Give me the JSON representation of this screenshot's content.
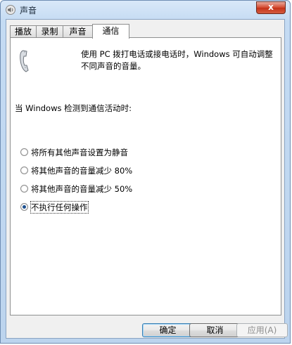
{
  "window": {
    "title": "声音",
    "close_label": "x"
  },
  "tabs": [
    {
      "label": "播放"
    },
    {
      "label": "录制"
    },
    {
      "label": "声音"
    },
    {
      "label": "通信"
    }
  ],
  "communications": {
    "description": "使用 PC 拨打电话或接电话时，Windows 可自动调整不同声音的音量。",
    "section_label": "当 Windows 检测到通信活动时:",
    "options": [
      {
        "label": "将所有其他声音设置为静音",
        "checked": false
      },
      {
        "label": "将其他声音的音量减少 80%",
        "checked": false
      },
      {
        "label": "将其他声音的音量减少 50%",
        "checked": false
      },
      {
        "label": "不执行任何操作",
        "checked": true
      }
    ]
  },
  "buttons": {
    "ok": "确定",
    "cancel": "取消",
    "apply": "应用(A)"
  }
}
